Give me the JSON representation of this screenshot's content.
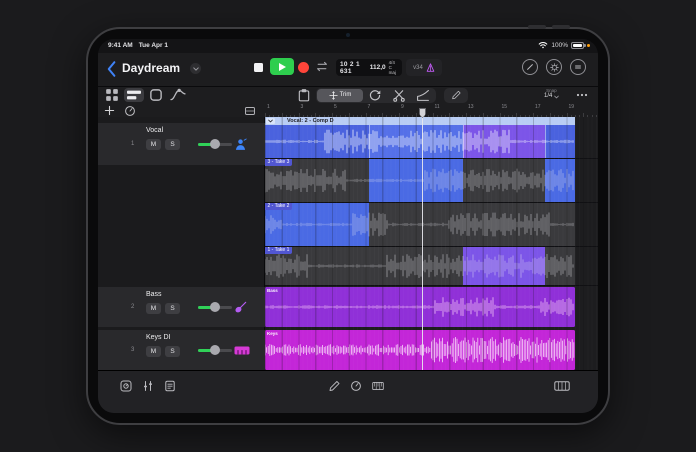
{
  "status": {
    "time": "9:41 AM",
    "date": "Tue Apr 1",
    "battery_percent": "100%"
  },
  "header": {
    "title": "Daydream"
  },
  "transport": {
    "lcd": {
      "position": "10 2 1 631",
      "tempo": "112,0",
      "time_signature": "4/4",
      "key": "C maj"
    },
    "badge": "v34"
  },
  "edit_tools": {
    "trim_label": "Trim"
  },
  "snap": {
    "label": "Snap",
    "value": "1/4"
  },
  "ruler_numbers": [
    "1",
    "3",
    "5",
    "7",
    "9",
    "11",
    "13",
    "15",
    "17",
    "19"
  ],
  "tracks": [
    {
      "number": "1",
      "name": "Vocal",
      "mute": "M",
      "solo": "S",
      "icon": "singer",
      "accent": "#3d84f7"
    },
    {
      "number": "2",
      "name": "Bass",
      "mute": "M",
      "solo": "S",
      "icon": "bassGuitar",
      "accent": "#b45cf2"
    },
    {
      "number": "3",
      "name": "Keys DI",
      "mute": "M",
      "solo": "S",
      "icon": "keysBadge",
      "accent": "#d63ad6"
    }
  ],
  "timeline": {
    "comp_region": {
      "label": "Vocal: 2 - Comp D",
      "segments": [
        {
          "from": 0,
          "to": 0.335,
          "color": "#4a62de"
        },
        {
          "from": 0.335,
          "to": 0.639,
          "color": "#5570e8"
        },
        {
          "from": 0.639,
          "to": 0.903,
          "color": "#7c55e8"
        },
        {
          "from": 0.903,
          "to": 1,
          "color": "#4a62de"
        }
      ]
    },
    "takes": [
      {
        "label": "3 - Take 3",
        "selected_sections": [
          {
            "from": 0.335,
            "to": 0.639,
            "color": "#4a6ae4"
          },
          {
            "from": 0.903,
            "to": 1,
            "color": "#4a6ae4"
          }
        ]
      },
      {
        "label": "2 - Take 2",
        "selected_sections": [
          {
            "from": 0,
            "to": 0.335,
            "color": "#4a6ae4"
          }
        ]
      },
      {
        "label": "1 - Take 1",
        "selected_sections": [
          {
            "from": 0.639,
            "to": 0.903,
            "color": "#7c55e8"
          }
        ]
      }
    ],
    "audio_regions": [
      {
        "label": "Bass",
        "color": "#9030d8",
        "wave_color": "#f0c4f4"
      },
      {
        "label": "Keys",
        "color": "#c326d8",
        "wave_color": "#f6d2f8"
      }
    ]
  },
  "colors": {
    "play_green": "#2ece4e",
    "record_red": "#ff453a",
    "metronome_purple": "#bf5af2",
    "take_lane_bg": "#3a3a3d",
    "strip_blue": "#b9cdf4",
    "slider_green": "#30d158"
  }
}
